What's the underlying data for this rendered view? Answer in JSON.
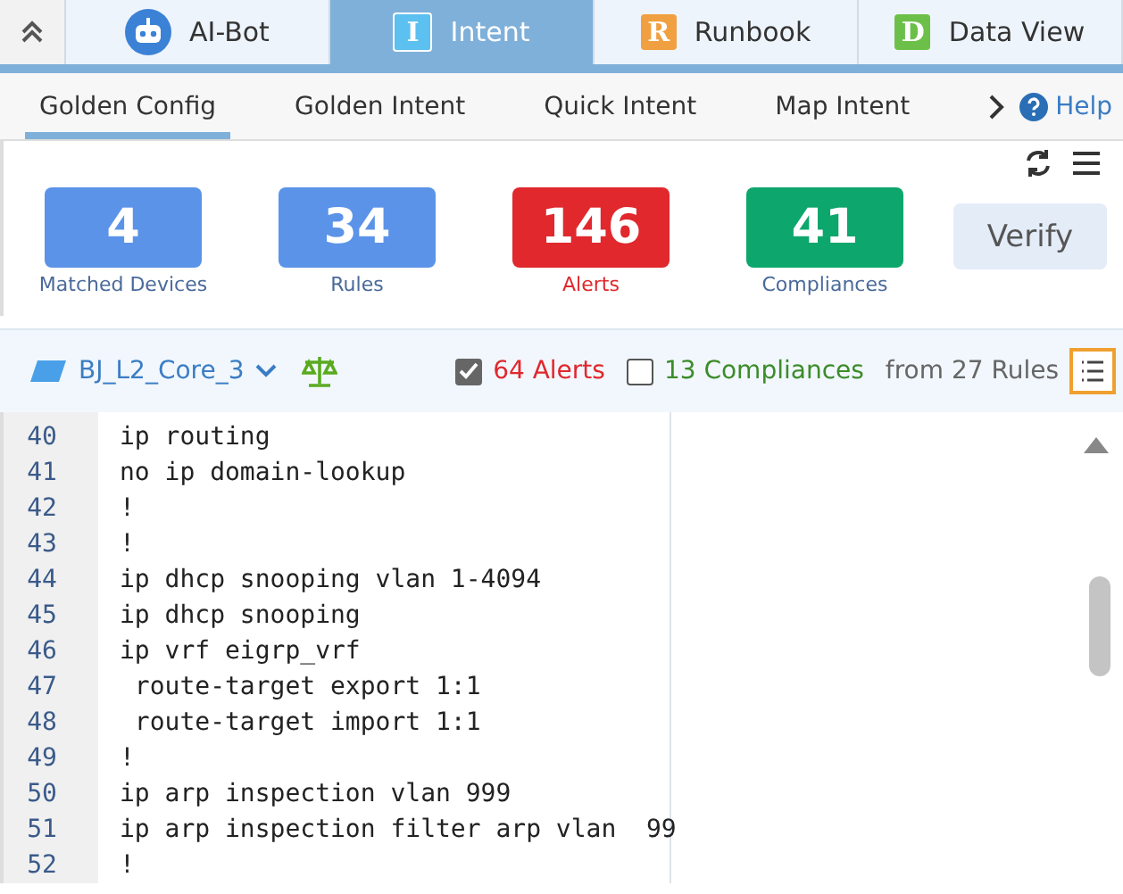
{
  "app_tabs": [
    {
      "label": "AI-Bot",
      "kind": "robot",
      "selected": false
    },
    {
      "label": "Intent",
      "kind": "I",
      "selected": true
    },
    {
      "label": "Runbook",
      "kind": "R",
      "selected": false
    },
    {
      "label": "Data View",
      "kind": "D",
      "selected": false
    }
  ],
  "sub_tabs": [
    {
      "label": "Golden Config",
      "selected": true
    },
    {
      "label": "Golden Intent",
      "selected": false
    },
    {
      "label": "Quick Intent",
      "selected": false
    },
    {
      "label": "Map Intent",
      "selected": false
    }
  ],
  "help": "Help",
  "metrics": [
    {
      "value": "4",
      "label": "Matched Devices",
      "color": "#5b93e8"
    },
    {
      "value": "34",
      "label": "Rules",
      "color": "#5b93e8"
    },
    {
      "value": "146",
      "label": "Alerts",
      "color": "#e0282d"
    },
    {
      "value": "41",
      "label": "Compliances",
      "color": "#0da66c"
    }
  ],
  "verify_button": "Verify",
  "device": "BJ_L2_Core_3",
  "filters": [
    {
      "label": "64 Alerts",
      "checked": true,
      "color": "#e0282d"
    },
    {
      "label": "13 Compliances",
      "checked": false,
      "color": "#3c8c2a"
    }
  ],
  "rules_note": "from 27 Rules",
  "code_lines": [
    {
      "number": "40",
      "text": "ip routing"
    },
    {
      "number": "41",
      "text": "no ip domain-lookup"
    },
    {
      "number": "42",
      "text": "!"
    },
    {
      "number": "43",
      "text": "!"
    },
    {
      "number": "44",
      "text": "ip dhcp snooping vlan 1-4094"
    },
    {
      "number": "45",
      "text": "ip dhcp snooping"
    },
    {
      "number": "46",
      "text": "ip vrf eigrp_vrf"
    },
    {
      "number": "47",
      "text": " route-target export 1:1"
    },
    {
      "number": "48",
      "text": " route-target import 1:1"
    },
    {
      "number": "49",
      "text": "!"
    },
    {
      "number": "50",
      "text": "ip arp inspection vlan 999"
    },
    {
      "number": "51",
      "text": "ip arp inspection filter arp vlan  99"
    },
    {
      "number": "52",
      "text": "!"
    }
  ]
}
